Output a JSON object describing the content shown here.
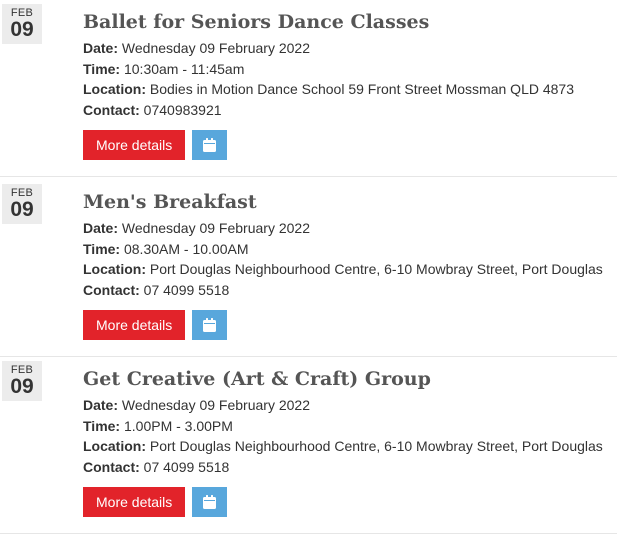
{
  "labels": {
    "date": "Date:",
    "time": "Time:",
    "location": "Location:",
    "contact": "Contact:",
    "more_details": "More details"
  },
  "events": [
    {
      "month": "FEB",
      "day": "09",
      "title": "Ballet for Seniors Dance Classes",
      "date": "Wednesday 09 February 2022",
      "time": "10:30am - 11:45am",
      "location": "Bodies in Motion Dance School 59 Front Street Mossman QLD 4873",
      "contact": "0740983921"
    },
    {
      "month": "FEB",
      "day": "09",
      "title": "Men's Breakfast",
      "date": "Wednesday 09 February 2022",
      "time": "08.30AM - 10.00AM",
      "location": "Port Douglas Neighbourhood Centre, 6-10 Mowbray Street, Port Douglas",
      "contact": "07 4099 5518"
    },
    {
      "month": "FEB",
      "day": "09",
      "title": "Get Creative (Art & Craft) Group",
      "date": "Wednesday 09 February 2022",
      "time": "1.00PM - 3.00PM",
      "location": "Port Douglas Neighbourhood Centre, 6-10 Mowbray Street, Port Douglas",
      "contact": "07 4099 5518"
    }
  ],
  "colors": {
    "more_button": "#e2232a",
    "calendar_button": "#58a7dc",
    "date_badge": "#ececec"
  },
  "icons": {
    "calendar": "calendar-icon"
  }
}
